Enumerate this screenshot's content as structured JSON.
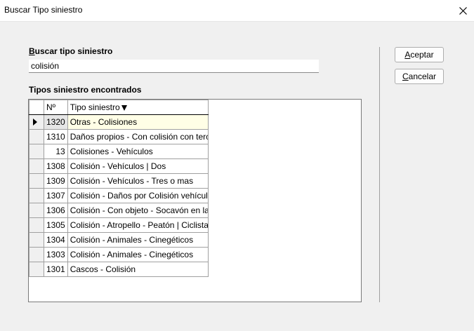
{
  "window": {
    "title": "Buscar Tipo siniestro",
    "close_icon": "close-icon"
  },
  "search": {
    "label_access_key": "B",
    "label_rest": "uscar tipo siniestro",
    "value": "colisión"
  },
  "results": {
    "label": "Tipos siniestro encontrados",
    "columns": {
      "num": "Nº",
      "name": "Tipo siniestro"
    },
    "sort_indicator": "descending-arrow-icon",
    "selected_row_index": 0,
    "rows": [
      {
        "num": "1320",
        "name": "Otras - Colisiones"
      },
      {
        "num": "1310",
        "name": "Daños propios - Con colisión con tercero"
      },
      {
        "num": "13",
        "name": "Colisiones - Vehículos"
      },
      {
        "num": "1308",
        "name": "Colisión - Vehículos | Dos"
      },
      {
        "num": "1309",
        "name": "Colisión - Vehículos - Tres o mas"
      },
      {
        "num": "1307",
        "name": "Colisión - Daños por Colisión vehículo c"
      },
      {
        "num": "1306",
        "name": "Colisión - Con objeto - Socavón en la ví"
      },
      {
        "num": "1305",
        "name": "Colisión - Atropello - Peatón | Ciclista"
      },
      {
        "num": "1304",
        "name": "Colisión - Animales - Cinegéticos"
      },
      {
        "num": "1303",
        "name": "Colisión - Animales - Cinegéticos"
      },
      {
        "num": "1301",
        "name": "Cascos - Colisión"
      }
    ]
  },
  "buttons": {
    "ok_access_key": "A",
    "ok_rest": "ceptar",
    "cancel_access_key": "C",
    "cancel_rest": "ancelar"
  },
  "colors": {
    "window_bg": "#f0f0f0",
    "current_row_bg": "#fffee6"
  }
}
